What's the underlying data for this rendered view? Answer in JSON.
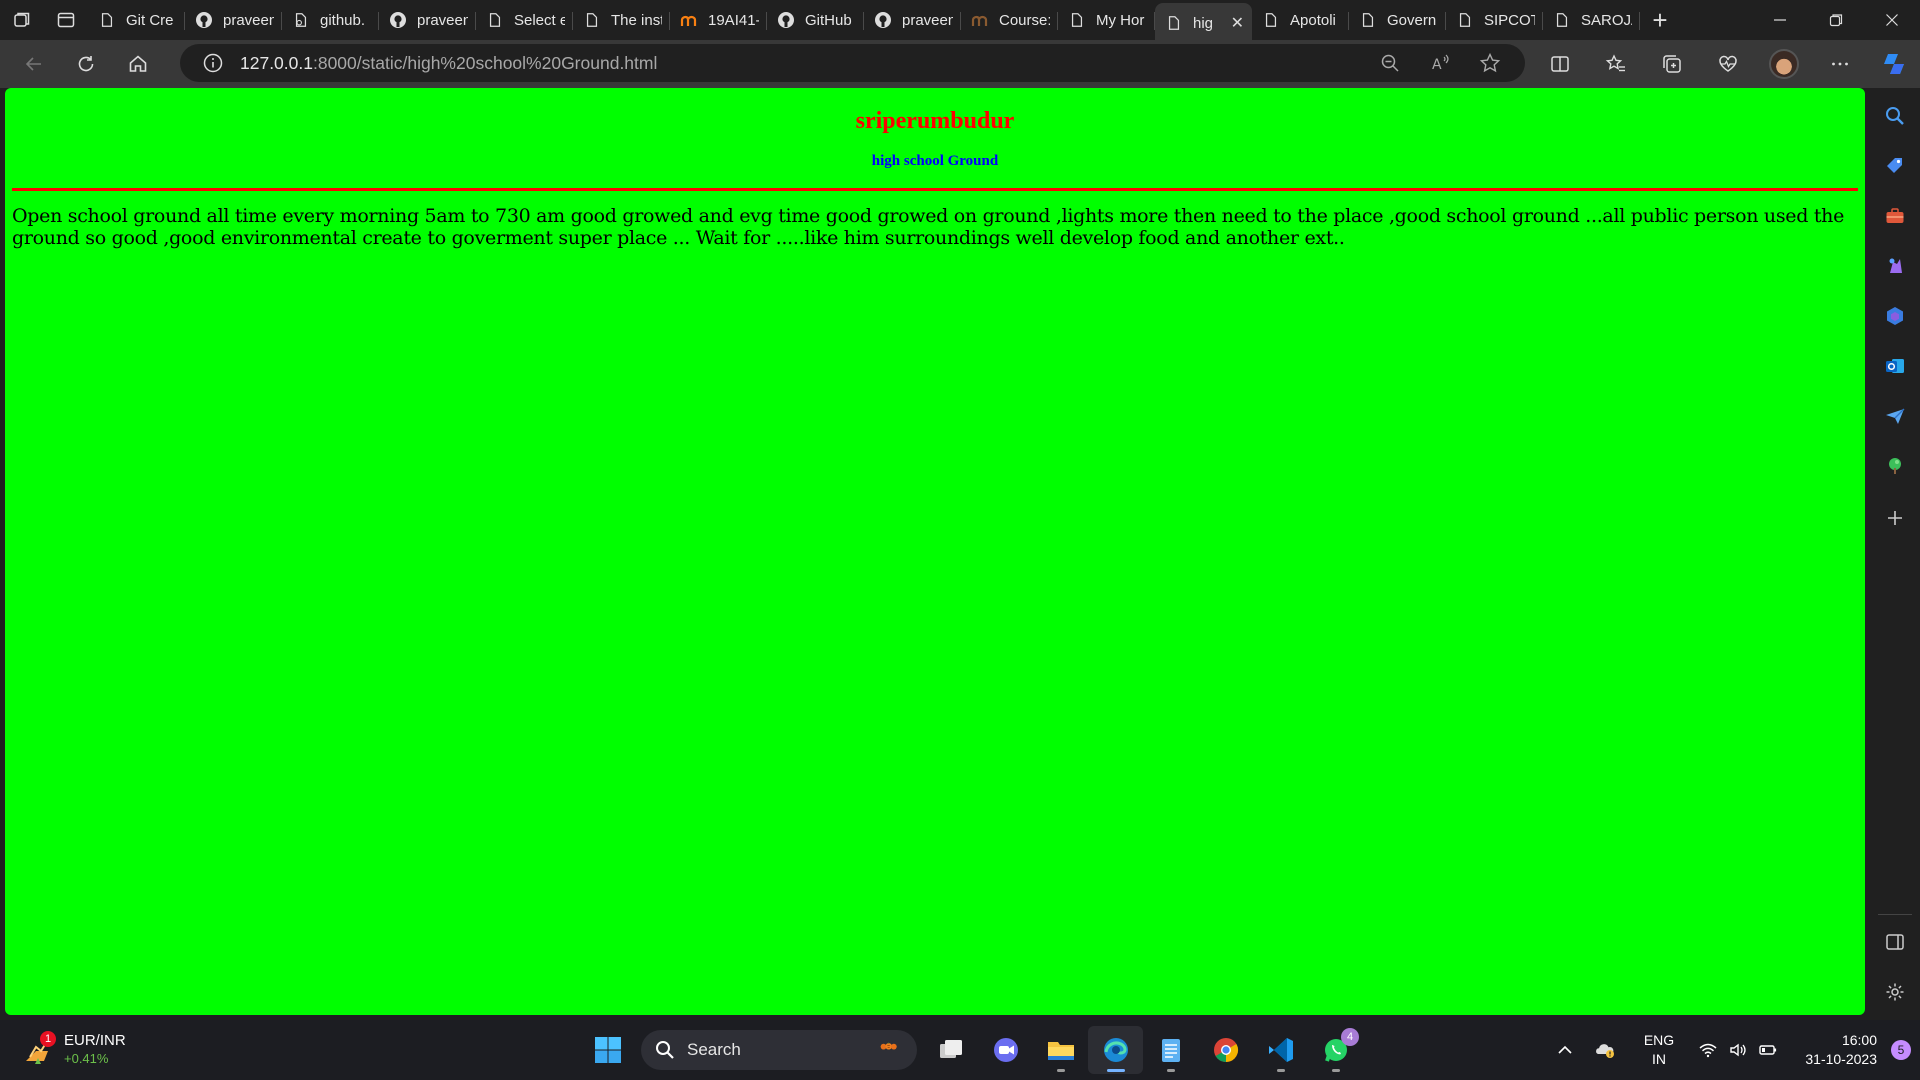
{
  "browser": {
    "tabs": [
      {
        "label": "Git Cre",
        "icon": "page-icon"
      },
      {
        "label": "praveen",
        "icon": "github-icon"
      },
      {
        "label": "github.",
        "icon": "github-copilot-icon"
      },
      {
        "label": "praveen",
        "icon": "github-icon"
      },
      {
        "label": "Select e",
        "icon": "page-icon"
      },
      {
        "label": "The inst",
        "icon": "page-icon"
      },
      {
        "label": "19AI41-",
        "icon": "moodle-icon"
      },
      {
        "label": "GitHub",
        "icon": "github-icon"
      },
      {
        "label": "praveen",
        "icon": "github-icon"
      },
      {
        "label": "Course:",
        "icon": "moodle-icon"
      },
      {
        "label": "My Hor",
        "icon": "page-icon"
      },
      {
        "label": "hig",
        "icon": "page-icon",
        "active": true
      },
      {
        "label": "Apotoli",
        "icon": "page-icon"
      },
      {
        "label": "Govern",
        "icon": "page-icon"
      },
      {
        "label": "SIPCOT",
        "icon": "page-icon"
      },
      {
        "label": "SAROJA",
        "icon": "page-icon"
      }
    ],
    "url_host": "127.0.0.1",
    "url_path": ":8000/static/high%20school%20Ground.html"
  },
  "page": {
    "heading": "sriperumbudur",
    "subheading": "high school Ground",
    "paragraph": "Open school ground all time every morning 5am to 730 am good growed and evg time good growed on ground ,lights more then need to the place ,good school ground ...all public person used the ground so good ,good environmental create to goverment super place ... Wait for .....like him surroundings well develop food and another ext..",
    "background_color": "#00ff00",
    "heading_color": "#ff0000",
    "subheading_color": "#0000ff",
    "rule_color": "#ff0000"
  },
  "taskbar": {
    "widget": {
      "badge": "1",
      "title": "EUR/INR",
      "change": "+0.41%"
    },
    "search_label": "Search",
    "whatsapp_badge": "4",
    "lang_line1": "ENG",
    "lang_line2": "IN",
    "time": "16:00",
    "date": "31-10-2023",
    "notification_count": "5"
  }
}
